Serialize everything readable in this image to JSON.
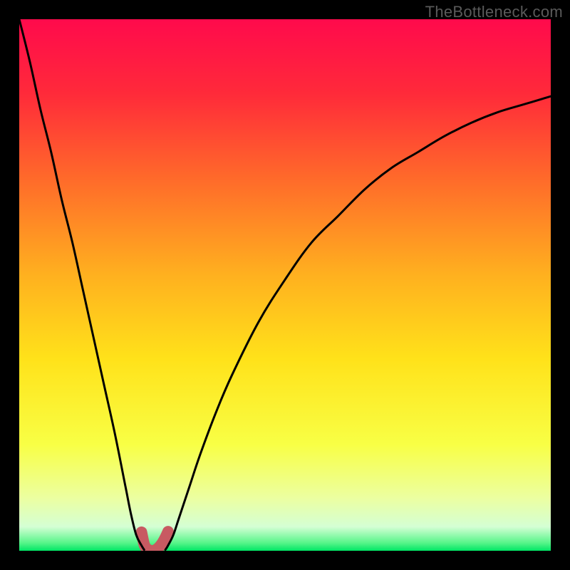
{
  "watermark": "TheBottleneck.com",
  "chart_data": {
    "type": "line",
    "title": "",
    "xlabel": "",
    "ylabel": "",
    "xlim": [
      0,
      100
    ],
    "ylim": [
      0,
      100
    ],
    "series": [
      {
        "name": "left-curve",
        "x": [
          0,
          2,
          4,
          6,
          8,
          10,
          12,
          14,
          16,
          18,
          20,
          21,
          22,
          23,
          23.5
        ],
        "y": [
          100,
          92,
          83,
          75,
          66,
          58,
          49,
          40,
          31,
          22,
          12,
          7,
          3,
          1,
          0.2
        ]
      },
      {
        "name": "right-curve",
        "x": [
          27.5,
          28,
          29,
          30,
          32,
          34,
          37,
          40,
          45,
          50,
          55,
          60,
          65,
          70,
          75,
          80,
          85,
          90,
          95,
          100
        ],
        "y": [
          0.2,
          1,
          3,
          6,
          12,
          18,
          26,
          33,
          43,
          51,
          58,
          63,
          68,
          72,
          75,
          78,
          80.5,
          82.5,
          84,
          85.5
        ]
      },
      {
        "name": "trough-highlight",
        "x": [
          23,
          23.5,
          24,
          24.5,
          25,
          25.5,
          26,
          26.5,
          27,
          27.5,
          28
        ],
        "y": [
          3.5,
          1.2,
          0.4,
          0.1,
          0,
          0.1,
          0.4,
          0.9,
          1.6,
          2.5,
          3.6
        ]
      }
    ],
    "background_gradient": {
      "stops": [
        {
          "pos": 0.0,
          "color": "#ff0a4c"
        },
        {
          "pos": 0.14,
          "color": "#ff2a3a"
        },
        {
          "pos": 0.3,
          "color": "#ff6a2a"
        },
        {
          "pos": 0.48,
          "color": "#ffb01f"
        },
        {
          "pos": 0.64,
          "color": "#ffe21a"
        },
        {
          "pos": 0.8,
          "color": "#f8ff45"
        },
        {
          "pos": 0.9,
          "color": "#ecffa0"
        },
        {
          "pos": 0.955,
          "color": "#d4ffd4"
        },
        {
          "pos": 0.985,
          "color": "#58f58a"
        },
        {
          "pos": 1.0,
          "color": "#00e665"
        }
      ]
    },
    "trough_color": "#c85a62",
    "curve_color": "#000000"
  }
}
